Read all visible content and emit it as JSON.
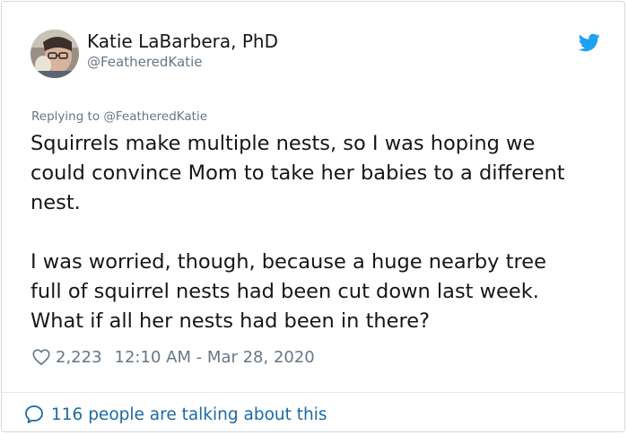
{
  "tweet": {
    "author_name": "Katie LaBarbera, PhD",
    "author_handle": "@FeatheredKatie",
    "replying_to": "Replying to @FeatheredKatie",
    "lines_para1": [
      "Squirrels make multiple nests, so I was hoping we",
      "could convince Mom to take her babies to a different",
      "nest."
    ],
    "lines_para2": [
      "I was worried, though, because a huge nearby tree",
      "full of squirrel nests had been cut down last week.",
      "What if all her nests had been in there?"
    ],
    "likes": "2,223",
    "timestamp": "12:10 AM - Mar 28, 2020",
    "talking": "116 people are talking about this"
  },
  "icons": {
    "avatar": "profile-photo",
    "brand": "twitter-bird-icon",
    "like": "heart-outline-icon",
    "reply": "speech-bubble-icon"
  },
  "colors": {
    "brand": "#1da1f2",
    "link": "#1b6aa5",
    "muted": "#657786",
    "text": "#14171a"
  }
}
